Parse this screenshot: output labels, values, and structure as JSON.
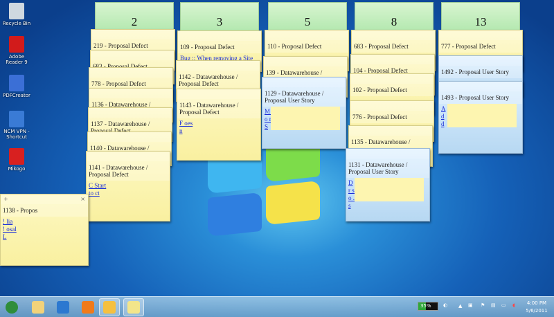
{
  "desktop_icons": [
    {
      "label": "Recycle Bin",
      "icon": "recycle-bin-icon",
      "color": "#cfd8e0"
    },
    {
      "label": "Adobe Reader 9",
      "icon": "adobe-reader-icon",
      "color": "#d21b1b"
    },
    {
      "label": "PDFCreator",
      "icon": "pdfcreator-icon",
      "color": "#3b6fd6"
    },
    {
      "label": "NCM VPN - Shortcut",
      "icon": "vpn-icon",
      "color": "#3a7bd5"
    },
    {
      "label": "Mikogo",
      "icon": "mikogo-icon",
      "color": "#d82020"
    }
  ],
  "columns": [
    "2",
    "3",
    "5",
    "8",
    "13"
  ],
  "notes": [
    {
      "title": "219 - Proposal Defect",
      "color": "yellow",
      "links": []
    },
    {
      "title": "683 - Proposal Defect",
      "color": "yellow",
      "links": []
    },
    {
      "title": "778 - Proposal Defect",
      "color": "yellow",
      "links": []
    },
    {
      "title": "1136 - Datawarehouse /",
      "color": "yellow",
      "links": []
    },
    {
      "title": "1137 - Datawarehouse / Proposal Defect",
      "color": "yellow",
      "links": []
    },
    {
      "title": "1140 - Datawarehouse / Proposal",
      "color": "yellow",
      "links": []
    },
    {
      "title": "1141 - Datawarehouse / Proposal Defect",
      "color": "yellow",
      "links": [
        "C                Start",
        "to                  ct"
      ]
    },
    {
      "title": "109 - Proposal Defect",
      "color": "yellow",
      "links": [
        "Bug :: When removing a Site"
      ]
    },
    {
      "title": "1142 - Datawarehouse / Proposal Defect",
      "color": "yellow",
      "links": []
    },
    {
      "title": "1143 - Datawarehouse / Proposal Defect",
      "color": "yellow",
      "links": [
        "F                    oes",
        "n"
      ]
    },
    {
      "title": "110 - Proposal Defect",
      "color": "yellow",
      "links": []
    },
    {
      "title": "139 - Datawarehouse / Proposal",
      "color": "yellow",
      "links": []
    },
    {
      "title": "1129 - Datawarehouse / Proposal User Story",
      "color": "blue",
      "links": [
        "M                  L",
        "o                  m",
        "S"
      ]
    },
    {
      "title": "683 - Proposal Defect",
      "color": "yellow",
      "links": []
    },
    {
      "title": "104 - Proposal Defect",
      "color": "yellow",
      "links": []
    },
    {
      "title": "102 - Proposal Defect",
      "color": "yellow",
      "links": []
    },
    {
      "title": "776 - Proposal Defect",
      "color": "yellow",
      "links": []
    },
    {
      "title": "1135 - Datawarehouse /",
      "color": "yellow",
      "links": []
    },
    {
      "title": "1131 - Datawarehouse / Proposal User Story",
      "color": "blue",
      "links": [
        "D",
        "r                     se",
        "o                      .",
        "s"
      ]
    },
    {
      "title": "777 - Proposal Defect",
      "color": "yellow",
      "links": []
    },
    {
      "title": "1492 - Proposal User Story",
      "color": "blue",
      "links": []
    },
    {
      "title": "1493 - Proposal User Story",
      "color": "blue",
      "links": [
        "A",
        "d",
        "d"
      ]
    },
    {
      "title": "1138 - Propos",
      "color": "yellow",
      "links": [
        "!                    lia",
        "!                   osal",
        "L"
      ],
      "add": "+",
      "close": "×"
    }
  ],
  "taskbar": {
    "apps": [
      {
        "name": "start-button",
        "icon": "windows-orb-icon",
        "color": "#2f8d3a"
      },
      {
        "name": "explorer",
        "icon": "folder-icon",
        "color": "#f2d27a"
      },
      {
        "name": "internet-explorer",
        "icon": "internet-explorer-icon",
        "color": "#2c78d0"
      },
      {
        "name": "media-player",
        "icon": "media-player-icon",
        "color": "#f07a1a"
      },
      {
        "name": "outlook",
        "icon": "outlook-icon",
        "color": "#f5c040"
      },
      {
        "name": "sticky-notes",
        "icon": "sticky-notes-icon",
        "color": "#f3e58a"
      }
    ],
    "battery": "35%",
    "time": "4:00 PM",
    "date": "5/6/2011"
  }
}
